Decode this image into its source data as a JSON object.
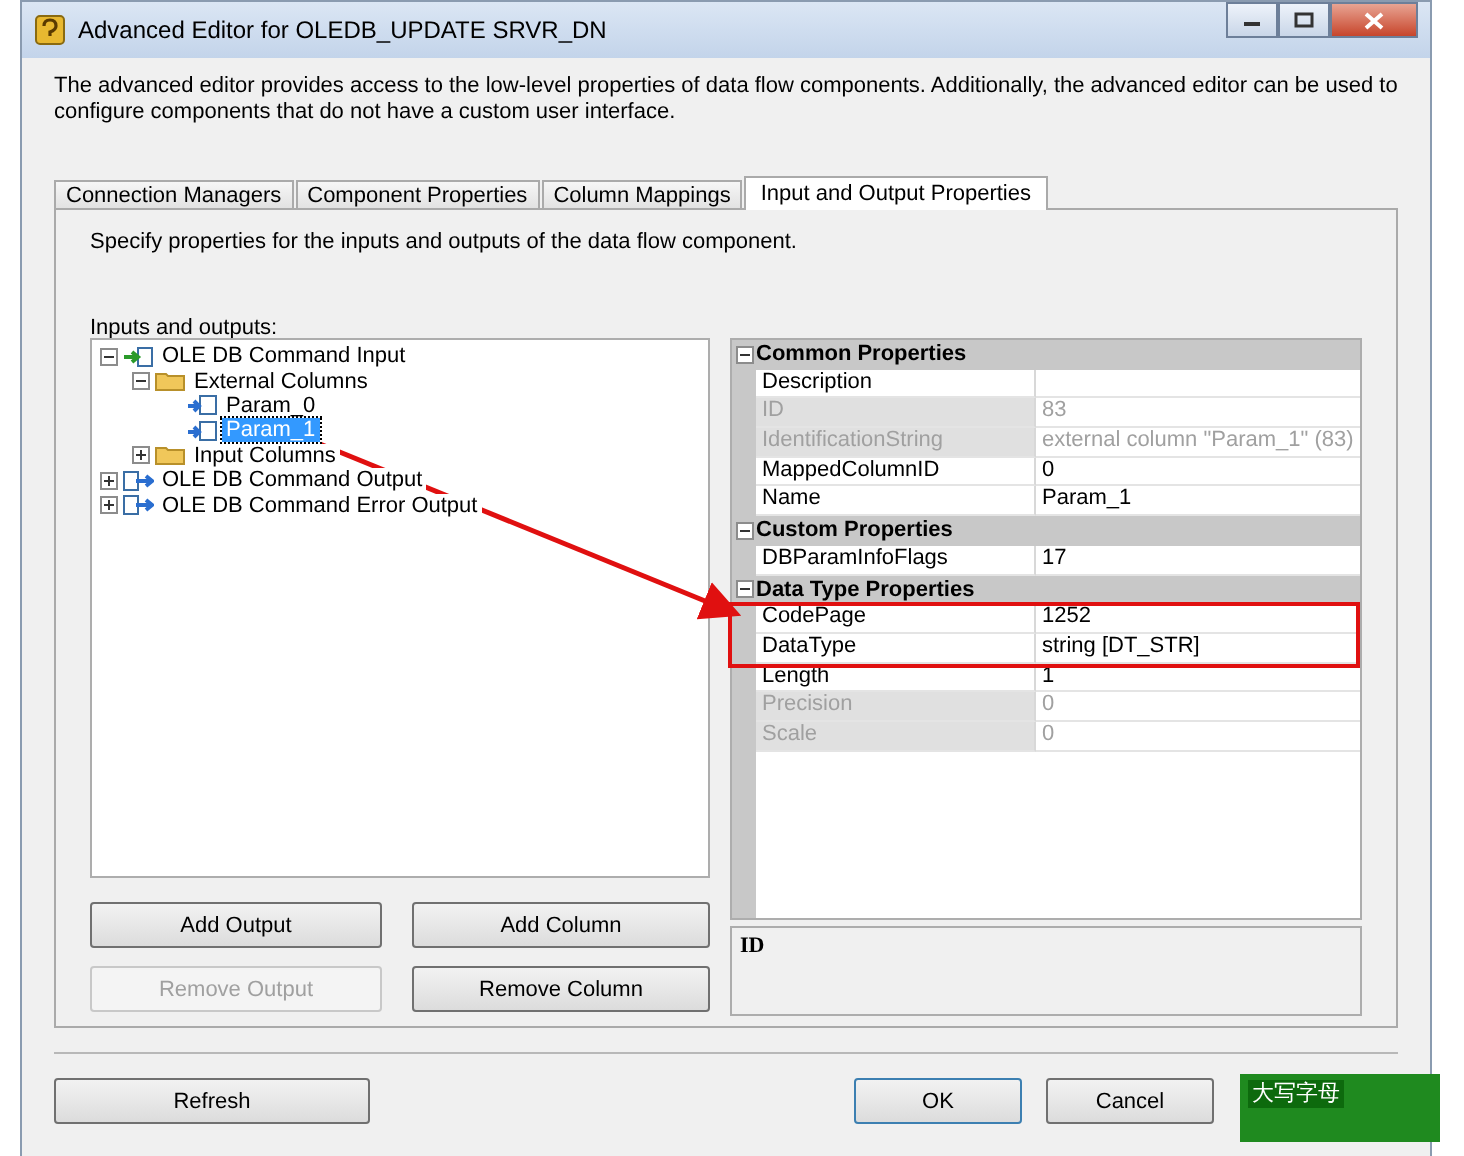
{
  "window": {
    "title": "Advanced Editor for OLEDB_UPDATE SRVR_DN"
  },
  "description": "The advanced editor provides access to the low-level properties of data flow components. Additionally, the advanced editor can be used to configure components that do not have a custom user interface.",
  "tabs": [
    {
      "label": "Connection Managers",
      "selected": false
    },
    {
      "label": "Component Properties",
      "selected": false
    },
    {
      "label": "Column Mappings",
      "selected": false
    },
    {
      "label": "Input and Output Properties",
      "selected": true
    }
  ],
  "instruction": "Specify properties for the inputs and outputs of the data flow component.",
  "tree_label": "Inputs and outputs:",
  "tree": [
    {
      "label": "OLE DB Command Input",
      "kind": "input",
      "expanded": true,
      "selected": false,
      "children": [
        {
          "label": "External Columns",
          "kind": "folder",
          "expanded": true,
          "selected": false,
          "children": [
            {
              "label": "Param_0",
              "kind": "column",
              "selected": false
            },
            {
              "label": "Param_1",
              "kind": "column",
              "selected": true
            }
          ]
        },
        {
          "label": "Input Columns",
          "kind": "folder",
          "expanded": false,
          "selected": false
        }
      ]
    },
    {
      "label": "OLE DB Command Output",
      "kind": "output",
      "expanded": false,
      "selected": false
    },
    {
      "label": "OLE DB Command Error Output",
      "kind": "output",
      "expanded": false,
      "selected": false
    }
  ],
  "properties": [
    {
      "category": "Common Properties",
      "expanded": true,
      "rows": [
        {
          "name": "Description",
          "value": "",
          "disabled": false,
          "highlighted": false
        },
        {
          "name": "ID",
          "value": "83",
          "disabled": true,
          "highlighted": false
        },
        {
          "name": "IdentificationString",
          "value": "external column \"Param_1\" (83)",
          "disabled": true,
          "highlighted": false
        },
        {
          "name": "MappedColumnID",
          "value": "0",
          "disabled": false,
          "highlighted": false
        },
        {
          "name": "Name",
          "value": "Param_1",
          "disabled": false,
          "highlighted": false
        }
      ]
    },
    {
      "category": "Custom Properties",
      "expanded": true,
      "rows": [
        {
          "name": "DBParamInfoFlags",
          "value": "17",
          "disabled": false,
          "highlighted": false
        }
      ]
    },
    {
      "category": "Data Type Properties",
      "expanded": true,
      "rows": [
        {
          "name": "CodePage",
          "value": "1252",
          "disabled": false,
          "highlighted": true
        },
        {
          "name": "DataType",
          "value": "string [DT_STR]",
          "disabled": false,
          "highlighted": true
        },
        {
          "name": "Length",
          "value": "1",
          "disabled": false,
          "highlighted": false
        },
        {
          "name": "Precision",
          "value": "0",
          "disabled": true,
          "highlighted": false
        },
        {
          "name": "Scale",
          "value": "0",
          "disabled": true,
          "highlighted": false
        }
      ]
    }
  ],
  "property_help": {
    "title": "ID"
  },
  "panel_buttons": [
    {
      "label": "Add Output",
      "disabled": false
    },
    {
      "label": "Add Column",
      "disabled": false
    },
    {
      "label": "Remove Output",
      "disabled": true
    },
    {
      "label": "Remove Column",
      "disabled": false
    }
  ],
  "dialog_buttons": [
    {
      "label": "Refresh"
    },
    {
      "label": "OK"
    },
    {
      "label": "Cancel"
    }
  ],
  "ime_bar": {
    "label": "大写字母"
  }
}
